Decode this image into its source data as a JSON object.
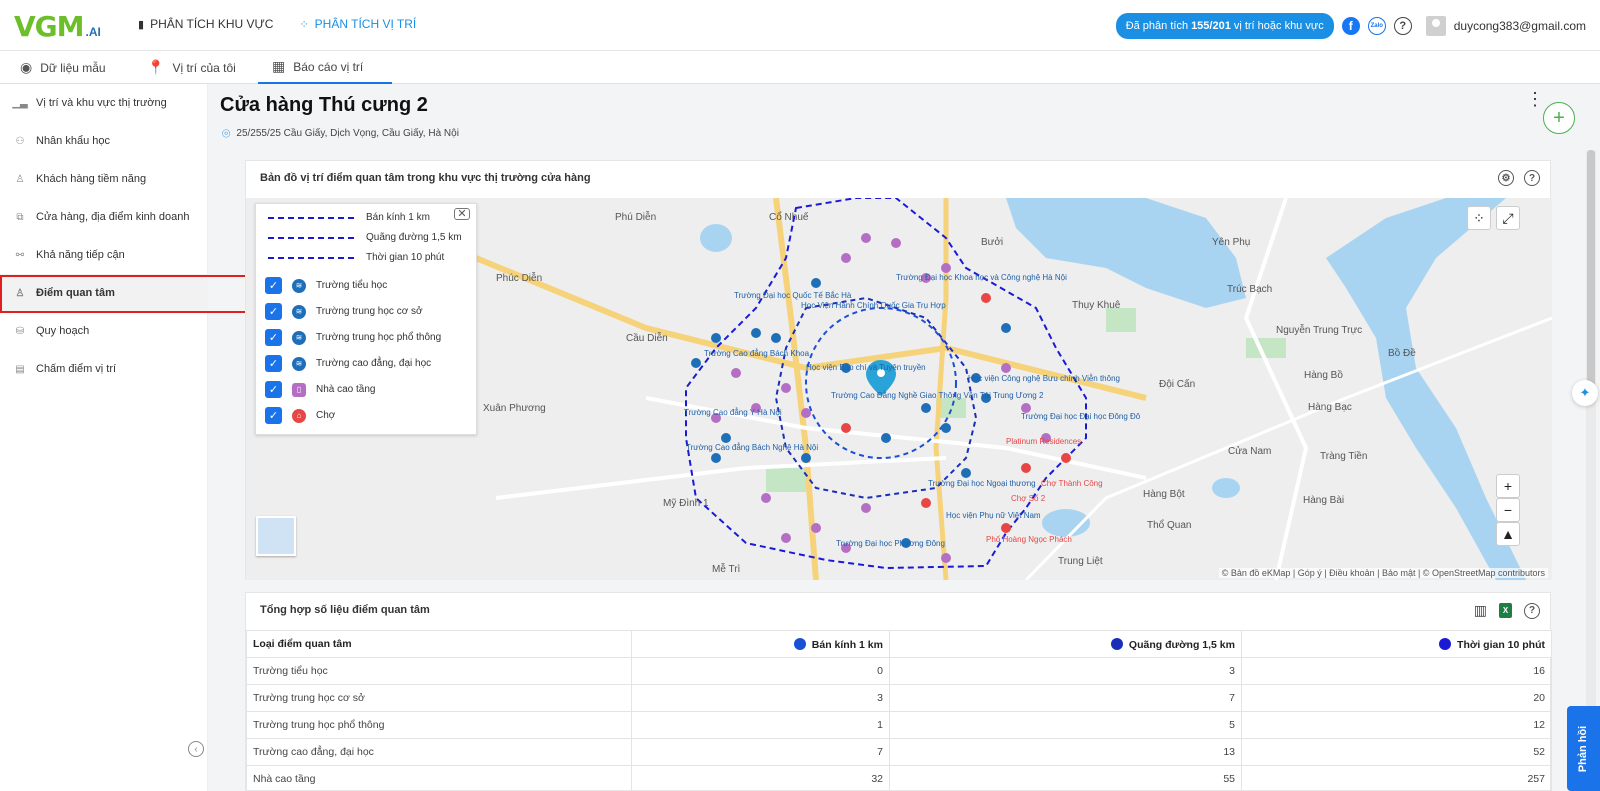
{
  "header": {
    "logo_text": "VGM",
    "logo_suffix": ".AI",
    "nav": [
      {
        "label": "PHÂN TÍCH KHU VỰC",
        "icon": "building-icon"
      },
      {
        "label": "PHÂN TÍCH VỊ TRÍ",
        "icon": "location-dot-icon",
        "active": true
      }
    ],
    "quota_prefix": "Đã phân tích",
    "quota_value": "155/201",
    "quota_suffix": "vị trí hoặc khu vực",
    "zalo_label": "Zalo",
    "user_email": "duycong383@gmail.com"
  },
  "tabs": [
    {
      "label": "Dữ liệu mẫu",
      "icon": "compass-icon"
    },
    {
      "label": "Vị trí của tôi",
      "icon": "map-pin-icon"
    },
    {
      "label": "Báo cáo vị trí",
      "icon": "dashboard-icon",
      "active": true
    }
  ],
  "sidebar": {
    "items": [
      {
        "label": "Vị trí và khu vực thị trường",
        "icon": "chart-icon"
      },
      {
        "label": "Nhân khẩu học",
        "icon": "people-icon"
      },
      {
        "label": "Khách hàng tiềm năng",
        "icon": "person-icon"
      },
      {
        "label": "Cửa hàng, địa điểm kinh doanh",
        "icon": "store-icon"
      },
      {
        "label": "Khả năng tiếp cận",
        "icon": "network-icon"
      },
      {
        "label": "Điểm quan tâm",
        "icon": "user-icon",
        "active": true
      },
      {
        "label": "Quy hoạch",
        "icon": "layers-icon"
      },
      {
        "label": "Chấm điểm vị trí",
        "icon": "document-icon"
      }
    ]
  },
  "store": {
    "title": "Cửa hàng Thú cưng 2",
    "address": "25/255/25 Cầu Giấy, Dịch Vọng, Cầu Giấy, Hà Nội"
  },
  "map_card": {
    "title": "Bản đồ vị trí điểm quan tâm trong khu vực thị trường cửa hàng",
    "legend_lines": [
      "Bán kính 1 km",
      "Quãng đường 1,5 km",
      "Thời gian 10 phút"
    ],
    "legend_items": [
      {
        "label": "Trường tiểu học",
        "type": "school",
        "checked": true
      },
      {
        "label": "Trường trung học cơ sở",
        "type": "school",
        "checked": true
      },
      {
        "label": "Trường trung học phổ thông",
        "type": "school",
        "checked": true
      },
      {
        "label": "Trường cao đẳng, đại học",
        "type": "school",
        "checked": true
      },
      {
        "label": "Nhà cao tầng",
        "type": "tower",
        "checked": true
      },
      {
        "label": "Chợ",
        "type": "market",
        "checked": true
      }
    ],
    "place_labels": [
      "Phú Diễn",
      "Cổ Nhuế",
      "Bưởi",
      "Yên Phụ",
      "Phúc Diễn",
      "Thụy Khuê",
      "Trúc Bạch",
      "Cầu Diễn",
      "Nguyễn Trung Trực",
      "Bồ Đề",
      "Hàng Bồ",
      "Đội Cấn",
      "Xuân Phương",
      "Hàng Bạc",
      "Cửa Nam",
      "Tràng Tiền",
      "Mỹ Đình 1",
      "Hàng Bột",
      "Hàng Bài",
      "Thổ Quan",
      "Trung Liệt",
      "Mễ Trì"
    ],
    "poi_labels": [
      "Trường Đại học Quốc Tế Bắc Hà",
      "Trường Đại học Khoa học và Công nghệ Hà Nội",
      "Học Viện Hành Chính Quốc Gia Trụ Hợp",
      "Trường Cao đẳng Bách Khoa",
      "Học viện Báo chí và Tuyên truyền",
      "Trường Cao Đẳng Nghề Giao Thông Vận Tải Trung Ương 2",
      "Học viện Công nghệ Bưu chính Viễn thông",
      "Trường Cao đẳng Y Hà Nội",
      "Trường Cao đẳng Bách Nghệ Hà Nội",
      "Trường Đại học Đại học Đông Đô",
      "Trường Đại học Ngoại thương",
      "Chợ Thành Công",
      "Học viện Phụ nữ Việt Nam",
      "Trường Đại học Phương Đông",
      "Phố Hoàng Ngọc Phách",
      "Chợ Số 2",
      "Platinum Residences"
    ],
    "attribution": "© Bản đồ eKMap | Góp ý | Điều khoản | Bảo mật | © OpenStreetMap contributors"
  },
  "stats_card": {
    "title": "Tổng hợp số liệu điểm quan tâm",
    "columns": [
      "Loại điểm quan tâm",
      "Bán kính 1 km",
      "Quãng đường 1,5 km",
      "Thời gian 10 phút"
    ],
    "column_colors": [
      "",
      "#1a4fd6",
      "#1a2fb8",
      "#1a1ad6"
    ],
    "rows": [
      [
        "Trường tiểu học",
        "0",
        "3",
        "16"
      ],
      [
        "Trường trung học cơ sở",
        "3",
        "7",
        "20"
      ],
      [
        "Trường trung học phổ thông",
        "1",
        "5",
        "12"
      ],
      [
        "Trường cao đẳng, đại học",
        "7",
        "13",
        "52"
      ],
      [
        "Nhà cao tầng",
        "32",
        "55",
        "257"
      ]
    ]
  },
  "feedback_label": "Phản hồi",
  "colors": {
    "accent": "#1a8fe3",
    "brand_green": "#6cbf2a",
    "highlight_border": "#e02020",
    "boundary_blue": "#1a1ad6"
  }
}
